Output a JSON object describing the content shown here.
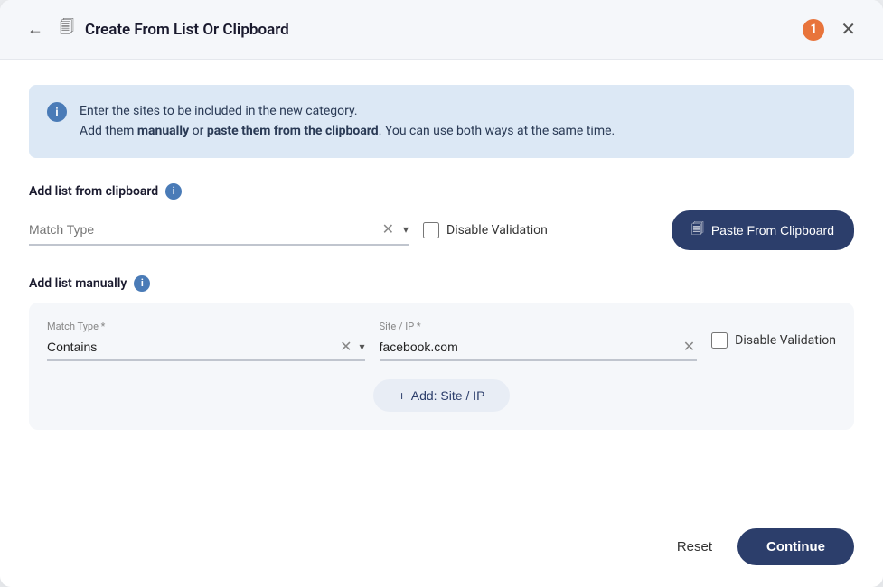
{
  "header": {
    "back_label": "←",
    "copy_icon": "🗐",
    "title": "Create From List Or Clipboard",
    "badge": "1",
    "close_icon": "✕"
  },
  "info_banner": {
    "icon": "i",
    "line1": "Enter the sites to be included in the new category.",
    "line2_prefix": "Add them ",
    "line2_bold1": "manually",
    "line2_mid": " or ",
    "line2_bold2": "paste them from the clipboard",
    "line2_suffix": ". You can use both ways at the same time."
  },
  "clipboard_section": {
    "label": "Add list from clipboard",
    "info_icon": "i",
    "match_type_placeholder": "Match Type",
    "disable_validation_label": "Disable Validation",
    "paste_btn_label": "Paste From Clipboard"
  },
  "manual_section": {
    "label": "Add list manually",
    "info_icon": "i",
    "match_type_label": "Match Type *",
    "match_type_value": "Contains",
    "site_ip_label": "Site / IP *",
    "site_ip_value": "facebook.com",
    "disable_validation_label": "Disable Validation",
    "add_btn_label": "Add: Site / IP"
  },
  "footer": {
    "reset_label": "Reset",
    "continue_label": "Continue"
  }
}
